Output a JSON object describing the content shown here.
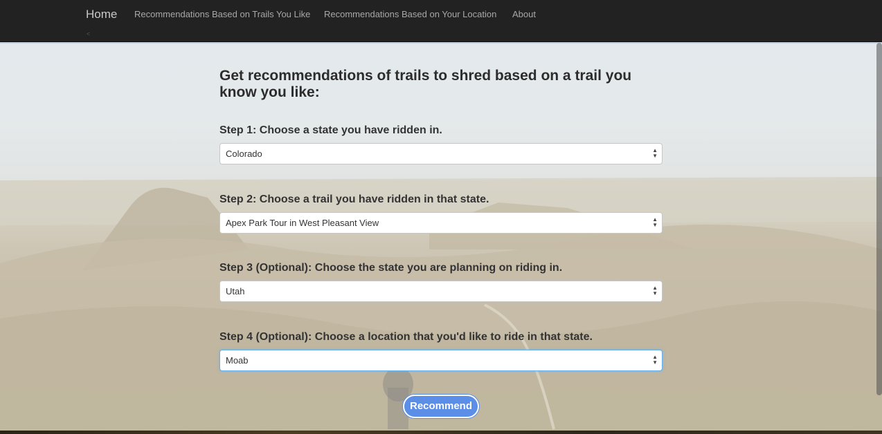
{
  "nav": {
    "brand": "Home",
    "links": [
      "Recommendations Based on Trails You Like",
      "Recommendations Based on Your Location",
      "About"
    ],
    "caret": "<"
  },
  "main": {
    "heading": "Get recommendations of trails to shred based on a trail you know you like:",
    "steps": [
      {
        "label": "Step 1: Choose a state you have ridden in.",
        "value": "Colorado"
      },
      {
        "label": "Step 2: Choose a trail you have ridden in that state.",
        "value": "Apex Park Tour in West Pleasant View"
      },
      {
        "label": "Step 3 (Optional): Choose the state you are planning on riding in.",
        "value": "Utah"
      },
      {
        "label": "Step 4 (Optional): Choose a location that you'd like to ride in that state.",
        "value": "Moab"
      }
    ],
    "button_label": "Recommend"
  },
  "icons": {
    "select_arrows": "up-down-arrows-icon"
  },
  "colors": {
    "navbar": "#222222",
    "button": "#5b8ee6",
    "focus_border": "#66afe9"
  }
}
